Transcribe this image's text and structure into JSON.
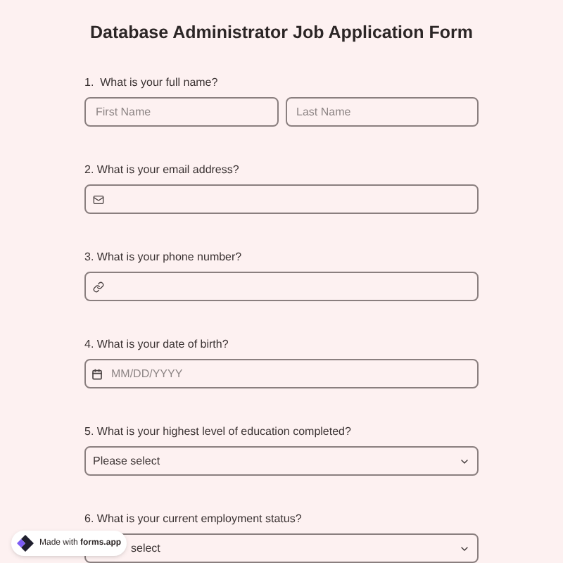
{
  "title": "Database Administrator Job Application Form",
  "questions": [
    {
      "label": "1.  What is your full name?",
      "kind": "name",
      "fields": [
        {
          "placeholder": "First Name"
        },
        {
          "placeholder": "Last Name"
        }
      ]
    },
    {
      "label": "2. What is your email address?",
      "kind": "email"
    },
    {
      "label": "3. What is your phone number?",
      "kind": "phone"
    },
    {
      "label": "4. What is your date of birth?",
      "kind": "date",
      "placeholder": "MM/DD/YYYY"
    },
    {
      "label": "5. What is your highest level of education completed?",
      "kind": "select",
      "value": "Please select"
    },
    {
      "label": "6. What is your current employment status?",
      "kind": "select",
      "value": "select"
    }
  ],
  "badge": {
    "text": "Made with **forms.app**"
  }
}
